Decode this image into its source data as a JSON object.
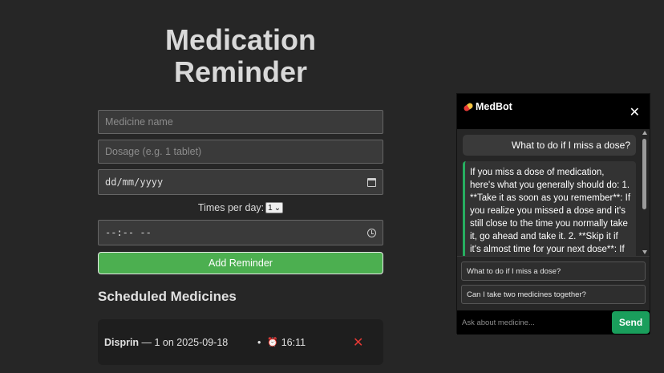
{
  "app": {
    "title_line1": "Medication",
    "title_line2": "Reminder"
  },
  "form": {
    "medicine_placeholder": "Medicine name",
    "dosage_placeholder": "Dosage (e.g. 1 tablet)",
    "date_value": "dd/mm/yyyy",
    "times_label": "Times per day:",
    "times_selected": "1",
    "time_value": "--:-- --",
    "add_button": "Add Reminder"
  },
  "scheduled": {
    "heading": "Scheduled Medicines",
    "items": [
      {
        "name": "Disprin",
        "detail": " — 1 on 2025-09-18",
        "bullet": "•",
        "time": "16:11"
      }
    ]
  },
  "chat": {
    "title": "MedBot",
    "user_message": "What to do if I miss a dose?",
    "bot_message": "If you miss a dose of medication, here's what you generally should do: 1. **Take it as soon as you remember**: If you realize you missed a dose and it's still close to the time you normally take it, go ahead and take it. 2. **Skip it if it's almost time for your next dose**: If it's",
    "suggestions": [
      "What to do if I miss a dose?",
      "Can I take two medicines together?"
    ],
    "input_placeholder": "Ask about medicine...",
    "send_label": "Send"
  },
  "colors": {
    "background": "#262626",
    "accent_green": "#4caf50",
    "send_green": "#1a9e5c",
    "delete_red": "#e53935"
  },
  "icons": {
    "calendar": "calendar-icon",
    "clock": "clock-icon",
    "alarm": "alarm-clock-icon",
    "delete": "delete-x-icon",
    "close": "close-icon",
    "pill": "pill-icon"
  }
}
